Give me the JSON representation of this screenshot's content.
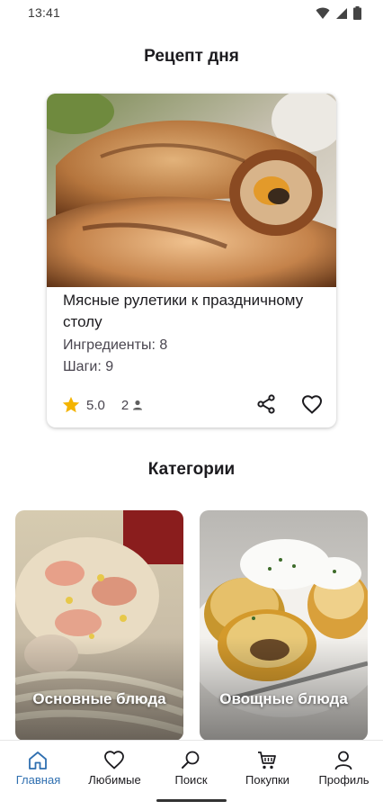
{
  "status_bar": {
    "time": "13:41"
  },
  "recipe_of_day": {
    "section_title": "Рецепт  дня",
    "name": "Мясные рулетики к праздничному столу",
    "ingredients": "Ингредиенты: 8",
    "steps": "Шаги: 9",
    "rating": "5.0",
    "portions": "2",
    "icons": {
      "rating": "star-icon",
      "portions": "person-icon",
      "share": "share-icon",
      "favorite": "heart-icon"
    },
    "star_color": "#f4b400"
  },
  "categories": {
    "section_title": "Категории",
    "items": [
      {
        "label": "Основные блюда"
      },
      {
        "label": "Овощные блюда"
      }
    ]
  },
  "bottom_nav": {
    "accent": "#2f6fb0",
    "items": [
      {
        "label": "Главная",
        "icon": "home-icon",
        "active": true
      },
      {
        "label": "Любимые",
        "icon": "heart-icon"
      },
      {
        "label": "Поиск",
        "icon": "search-icon"
      },
      {
        "label": "Покупки",
        "icon": "cart-icon"
      },
      {
        "label": "Профиль",
        "icon": "user-icon"
      }
    ]
  }
}
